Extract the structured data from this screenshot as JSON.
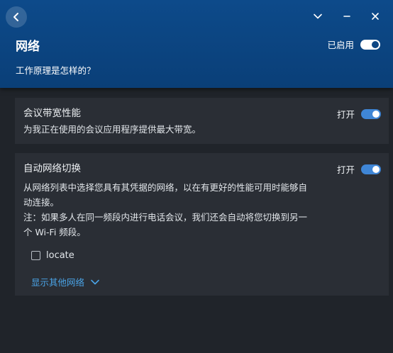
{
  "header": {
    "title": "网络",
    "how_it_works": "工作原理是怎样的？",
    "enabled_label": "已启用",
    "enabled_on": true
  },
  "cards": {
    "bandwidth": {
      "title": "会议带宽性能",
      "toggle_label": "打开",
      "toggle_on": true,
      "description": "为我正在使用的会议应用程序提供最大带宽。"
    },
    "auto_switch": {
      "title": "自动网络切换",
      "toggle_label": "打开",
      "toggle_on": true,
      "description_lines": [
        "从网络列表中选择您具有其凭据的网络，以在有更好的性能可用时能够自",
        "动连接。",
        "注：如果多人在同一频段内进行电话会议，我们还会自动将您切换到另一",
        "个 Wi-Fi 频段。"
      ],
      "network_option": "locate",
      "network_checked": false,
      "show_more": "显示其他网络"
    }
  },
  "colors": {
    "header_bg": "#0c4583",
    "card_bg": "#2a2e35",
    "page_bg": "#20242a",
    "toggle_blue": "#3f86d6",
    "link_blue": "#4aa3e6"
  },
  "icons": [
    "back-arrow-icon",
    "chevron-down-icon",
    "minimize-icon",
    "close-icon",
    "show-more-chevron-icon"
  ]
}
